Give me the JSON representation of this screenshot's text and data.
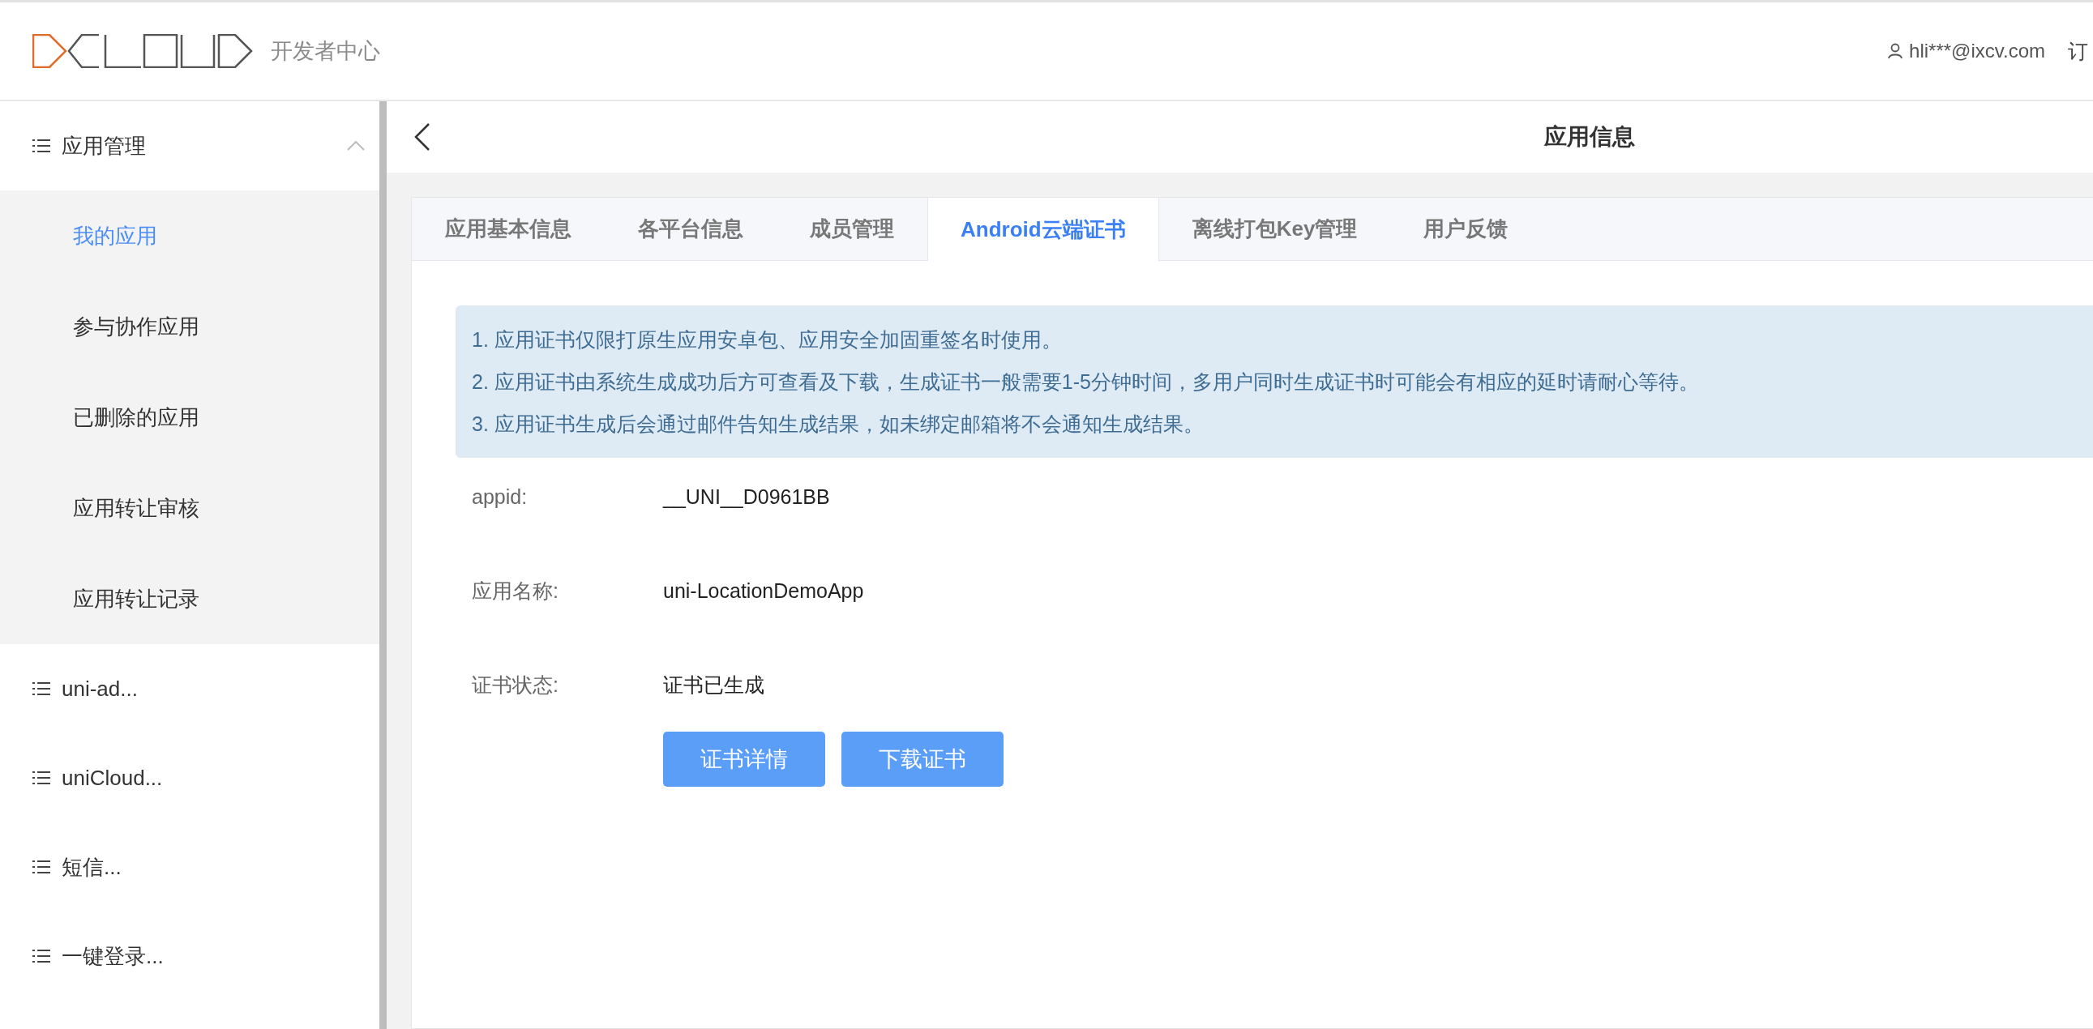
{
  "header": {
    "subtitle": "开发者中心",
    "user": "hli***@ixcv.com",
    "nav_item": "订"
  },
  "sidebar": {
    "groups": [
      {
        "label": "应用管理",
        "expanded": true,
        "children": [
          {
            "label": "我的应用",
            "selected": true
          },
          {
            "label": "参与协作应用",
            "selected": false
          },
          {
            "label": "已删除的应用",
            "selected": false
          },
          {
            "label": "应用转让审核",
            "selected": false
          },
          {
            "label": "应用转让记录",
            "selected": false
          }
        ]
      },
      {
        "label": "uni-ad...",
        "expanded": false
      },
      {
        "label": "uniCloud...",
        "expanded": false
      },
      {
        "label": "短信...",
        "expanded": false
      },
      {
        "label": "一键登录...",
        "expanded": false
      }
    ]
  },
  "page": {
    "title": "应用信息"
  },
  "tabs": [
    {
      "label": "应用基本信息",
      "selected": false
    },
    {
      "label": "各平台信息",
      "selected": false
    },
    {
      "label": "成员管理",
      "selected": false
    },
    {
      "label": "Android云端证书",
      "selected": true
    },
    {
      "label": "离线打包Key管理",
      "selected": false
    },
    {
      "label": "用户反馈",
      "selected": false
    }
  ],
  "notice": [
    "1. 应用证书仅限打原生应用安卓包、应用安全加固重签名时使用。",
    "2. 应用证书由系统生成成功后方可查看及下载，生成证书一般需要1-5分钟时间，多用户同时生成证书时可能会有相应的延时请耐心等待。",
    "3. 应用证书生成后会通过邮件告知生成结果，如未绑定邮箱将不会通知生成结果。"
  ],
  "fields": [
    {
      "label": "appid:",
      "value": "__UNI__D0961BB"
    },
    {
      "label": "应用名称:",
      "value": "uni-LocationDemoApp"
    },
    {
      "label": "证书状态:",
      "value": "证书已生成"
    }
  ],
  "buttons": [
    "证书详情",
    "下载证书"
  ]
}
